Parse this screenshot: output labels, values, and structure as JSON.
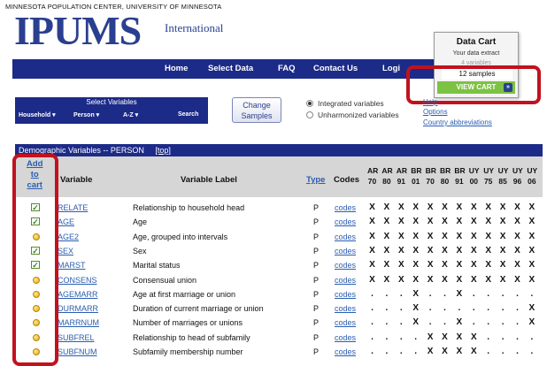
{
  "header": {
    "org": "MINNESOTA POPULATION CENTER, UNIVERSITY OF MINNESOTA",
    "logo": "IPUMS",
    "logo_sub": "International"
  },
  "nav": [
    "Home",
    "Select Data",
    "FAQ",
    "Contact Us",
    "Logi"
  ],
  "cart": {
    "title": "Data Cart",
    "subtitle": "Your data extract",
    "variables": "4 variables",
    "samples": "12 samples",
    "view_button": "VIEW CART",
    "arrow": "»"
  },
  "select_vars": {
    "title": "Select Variables",
    "dropdowns": [
      "Household ▾",
      "Person ▾",
      "A-Z ▾",
      "Search"
    ]
  },
  "change_samples": [
    "Change",
    "Samples"
  ],
  "radios": [
    {
      "label": "Integrated variables",
      "checked": true
    },
    {
      "label": "Unharmonized variables",
      "checked": false
    }
  ],
  "links": [
    "Help",
    "Options",
    "Country abbreviations"
  ],
  "table": {
    "section_title": "Demographic Variables -- PERSON",
    "top_link": "[top]",
    "headers": {
      "add": [
        "Add",
        "to",
        "cart"
      ],
      "variable": "Variable",
      "label": "Variable Label",
      "type": "Type",
      "codes": "Codes"
    },
    "samples": [
      [
        "AR",
        "70"
      ],
      [
        "AR",
        "80"
      ],
      [
        "AR",
        "91"
      ],
      [
        "BR",
        "01"
      ],
      [
        "BR",
        "70"
      ],
      [
        "BR",
        "80"
      ],
      [
        "BR",
        "91"
      ],
      [
        "UY",
        "00"
      ],
      [
        "UY",
        "75"
      ],
      [
        "UY",
        "85"
      ],
      [
        "UY",
        "96"
      ],
      [
        "UY",
        "06"
      ]
    ],
    "rows": [
      {
        "icon": "check",
        "variable": "RELATE",
        "label": "Relationship to household head",
        "type": "P",
        "codes": "codes",
        "marks": [
          "X",
          "X",
          "X",
          "X",
          "X",
          "X",
          "X",
          "X",
          "X",
          "X",
          "X",
          "X"
        ]
      },
      {
        "icon": "check",
        "variable": "AGE",
        "label": "Age",
        "type": "P",
        "codes": "codes",
        "marks": [
          "X",
          "X",
          "X",
          "X",
          "X",
          "X",
          "X",
          "X",
          "X",
          "X",
          "X",
          "X"
        ]
      },
      {
        "icon": "dot",
        "variable": "AGE2",
        "label": "Age, grouped into intervals",
        "type": "P",
        "codes": "codes",
        "marks": [
          "X",
          "X",
          "X",
          "X",
          "X",
          "X",
          "X",
          "X",
          "X",
          "X",
          "X",
          "X"
        ]
      },
      {
        "icon": "check",
        "variable": "SEX",
        "label": "Sex",
        "type": "P",
        "codes": "codes",
        "marks": [
          "X",
          "X",
          "X",
          "X",
          "X",
          "X",
          "X",
          "X",
          "X",
          "X",
          "X",
          "X"
        ]
      },
      {
        "icon": "check",
        "variable": "MARST",
        "label": "Marital status",
        "type": "P",
        "codes": "codes",
        "marks": [
          "X",
          "X",
          "X",
          "X",
          "X",
          "X",
          "X",
          "X",
          "X",
          "X",
          "X",
          "X"
        ]
      },
      {
        "icon": "dot",
        "variable": "CONSENS",
        "label": "Consensual union",
        "type": "P",
        "codes": "codes",
        "marks": [
          "X",
          "X",
          "X",
          "X",
          "X",
          "X",
          "X",
          "X",
          "X",
          "X",
          "X",
          "X"
        ]
      },
      {
        "icon": "dot",
        "variable": "AGEMARR",
        "label": "Age at first marriage or union",
        "type": "P",
        "codes": "codes",
        "marks": [
          ".",
          ".",
          ".",
          "X",
          ".",
          ".",
          "X",
          ".",
          ".",
          ".",
          ".",
          "."
        ]
      },
      {
        "icon": "dot",
        "variable": "DURMARR",
        "label": "Duration of current marriage or union",
        "type": "P",
        "codes": "codes",
        "marks": [
          ".",
          ".",
          ".",
          "X",
          ".",
          ".",
          ".",
          ".",
          ".",
          ".",
          ".",
          "X"
        ]
      },
      {
        "icon": "dot",
        "variable": "MARRNUM",
        "label": "Number of marriages or unions",
        "type": "P",
        "codes": "codes",
        "marks": [
          ".",
          ".",
          ".",
          "X",
          ".",
          ".",
          "X",
          ".",
          ".",
          ".",
          ".",
          "X"
        ]
      },
      {
        "icon": "dot",
        "variable": "SUBFREL",
        "label": "Relationship to head of subfamily",
        "type": "P",
        "codes": "codes",
        "marks": [
          ".",
          ".",
          ".",
          ".",
          "X",
          "X",
          "X",
          "X",
          ".",
          ".",
          ".",
          "."
        ]
      },
      {
        "icon": "dot",
        "variable": "SUBFNUM",
        "label": "Subfamily membership number",
        "type": "P",
        "codes": "codes",
        "marks": [
          ".",
          ".",
          ".",
          ".",
          "X",
          "X",
          "X",
          "X",
          ".",
          ".",
          ".",
          "."
        ]
      }
    ]
  },
  "colors": {
    "nav": "#1c2b88",
    "accent_green": "#7dc242",
    "highlight": "#c1121f",
    "link": "#2a5db0"
  }
}
